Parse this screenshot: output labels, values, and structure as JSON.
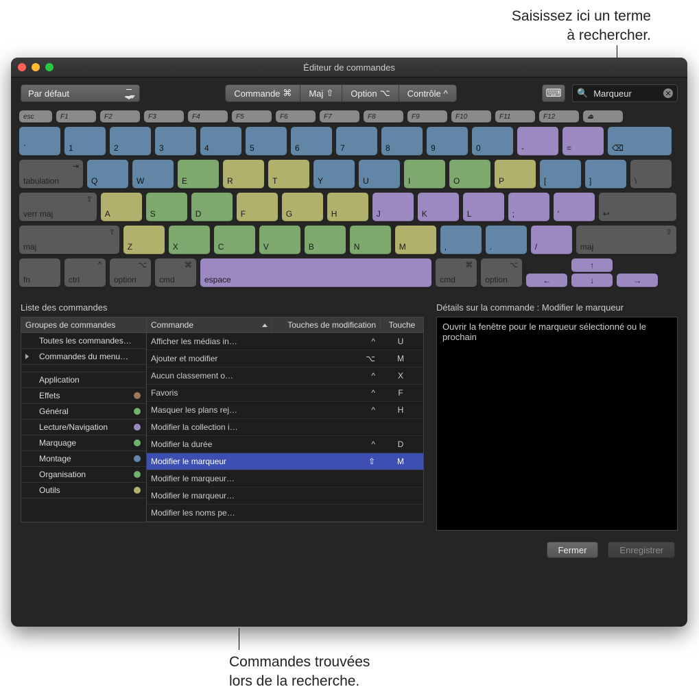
{
  "callouts": {
    "top": "Saisissez ici un terme\nà rechercher.",
    "bottom": "Commandes trouvées\nlors de la recherche."
  },
  "window": {
    "title": "Éditeur de commandes"
  },
  "toolbar": {
    "preset": "Par défaut",
    "mods": [
      {
        "label": "Commande",
        "glyph": "⌘"
      },
      {
        "label": "Maj",
        "glyph": "⇧"
      },
      {
        "label": "Option",
        "glyph": "⌥"
      },
      {
        "label": "Contrôle",
        "glyph": "^"
      }
    ],
    "search_value": "Marqueur"
  },
  "keyboard": {
    "frow": [
      "esc",
      "F1",
      "F2",
      "F3",
      "F4",
      "F5",
      "F6",
      "F7",
      "F8",
      "F9",
      "F10",
      "F11",
      "F12",
      "⏏"
    ],
    "row1": [
      {
        "l": "`",
        "c": "blue"
      },
      {
        "l": "1",
        "c": "blue"
      },
      {
        "l": "2",
        "c": "blue"
      },
      {
        "l": "3",
        "c": "blue"
      },
      {
        "l": "4",
        "c": "blue"
      },
      {
        "l": "5",
        "c": "blue"
      },
      {
        "l": "6",
        "c": "blue"
      },
      {
        "l": "7",
        "c": "blue"
      },
      {
        "l": "8",
        "c": "blue"
      },
      {
        "l": "9",
        "c": "blue"
      },
      {
        "l": "0",
        "c": "blue"
      },
      {
        "l": "-",
        "c": "purple"
      },
      {
        "l": "=",
        "c": "purple"
      },
      {
        "l": "⌫",
        "c": "blue",
        "w": 1.5
      }
    ],
    "row2": [
      {
        "l": "tabulation",
        "c": "dark",
        "w": 1.5,
        "sub": "⇥"
      },
      {
        "l": "Q",
        "c": "blue"
      },
      {
        "l": "W",
        "c": "blue"
      },
      {
        "l": "E",
        "c": "green"
      },
      {
        "l": "R",
        "c": "yellow"
      },
      {
        "l": "T",
        "c": "yellow"
      },
      {
        "l": "Y",
        "c": "blue"
      },
      {
        "l": "U",
        "c": "blue"
      },
      {
        "l": "I",
        "c": "green"
      },
      {
        "l": "O",
        "c": "green"
      },
      {
        "l": "P",
        "c": "yellow"
      },
      {
        "l": "[",
        "c": "blue"
      },
      {
        "l": "]",
        "c": "blue"
      },
      {
        "l": "\\",
        "c": "dark"
      }
    ],
    "row3": [
      {
        "l": "verr maj",
        "c": "dark",
        "w": 1.8,
        "sub": "⇪"
      },
      {
        "l": "A",
        "c": "yellow"
      },
      {
        "l": "S",
        "c": "green"
      },
      {
        "l": "D",
        "c": "green"
      },
      {
        "l": "F",
        "c": "yellow"
      },
      {
        "l": "G",
        "c": "yellow"
      },
      {
        "l": "H",
        "c": "yellow"
      },
      {
        "l": "J",
        "c": "purple"
      },
      {
        "l": "K",
        "c": "purple"
      },
      {
        "l": "L",
        "c": "purple"
      },
      {
        "l": ";",
        "c": "purple"
      },
      {
        "l": "'",
        "c": "purple"
      },
      {
        "l": "↩",
        "c": "dark",
        "w": 1.8
      }
    ],
    "row4": [
      {
        "l": "maj",
        "c": "dark",
        "w": 2.3,
        "sub": "⇧"
      },
      {
        "l": "Z",
        "c": "yellow"
      },
      {
        "l": "X",
        "c": "green"
      },
      {
        "l": "C",
        "c": "green"
      },
      {
        "l": "V",
        "c": "green"
      },
      {
        "l": "B",
        "c": "green"
      },
      {
        "l": "N",
        "c": "green"
      },
      {
        "l": "M",
        "c": "yellow"
      },
      {
        "l": ",",
        "c": "blue"
      },
      {
        "l": ".",
        "c": "blue"
      },
      {
        "l": "/",
        "c": "purple"
      },
      {
        "l": "maj",
        "c": "dark",
        "w": 2.3,
        "sub": "⇧"
      }
    ],
    "row5": [
      {
        "l": "fn",
        "c": "dark"
      },
      {
        "l": "ctrl",
        "c": "dark",
        "sub": "^"
      },
      {
        "l": "option",
        "c": "dark",
        "sub": "⌥"
      },
      {
        "l": "cmd",
        "c": "dark",
        "sub": "⌘"
      },
      {
        "l": "espace",
        "c": "purple",
        "w": 5.2
      },
      {
        "l": "cmd",
        "c": "dark",
        "sub": "⌘"
      },
      {
        "l": "option",
        "c": "dark",
        "sub": "⌥"
      },
      {
        "l": "←",
        "c": "purple",
        "h": 0.5
      },
      {
        "l": "↑↓",
        "c": "purple",
        "stack": true,
        "h": 0.5
      },
      {
        "l": "→",
        "c": "purple",
        "h": 0.5
      }
    ]
  },
  "lists": {
    "title": "Liste des commandes",
    "groups_header": "Groupes de commandes",
    "groups_top": [
      {
        "label": "Toutes les commandes…"
      },
      {
        "label": "Commandes du menu…",
        "disclosure": true
      }
    ],
    "groups": [
      {
        "label": "Application",
        "color": ""
      },
      {
        "label": "Effets",
        "color": "#a07858"
      },
      {
        "label": "Général",
        "color": "#6fb36f"
      },
      {
        "label": "Lecture/Navigation",
        "color": "#9d89c2"
      },
      {
        "label": "Marquage",
        "color": "#6fb36f"
      },
      {
        "label": "Montage",
        "color": "#6287a6"
      },
      {
        "label": "Organisation",
        "color": "#6fb36f"
      },
      {
        "label": "Outils",
        "color": "#b2b06d"
      }
    ],
    "columns": {
      "cmd": "Commande",
      "mod": "Touches de modification",
      "key": "Touche"
    },
    "rows": [
      {
        "cmd": "Afficher les médias in…",
        "mod": "^",
        "key": "U"
      },
      {
        "cmd": "Ajouter et modifier",
        "mod": "⌥",
        "key": "M"
      },
      {
        "cmd": "Aucun classement o…",
        "mod": "^",
        "key": "X"
      },
      {
        "cmd": "Favoris",
        "mod": "^",
        "key": "F"
      },
      {
        "cmd": "Masquer les plans rej…",
        "mod": "^",
        "key": "H"
      },
      {
        "cmd": "Modifier la collection i…",
        "mod": "",
        "key": ""
      },
      {
        "cmd": "Modifier la durée",
        "mod": "^",
        "key": "D"
      },
      {
        "cmd": "Modifier le marqueur",
        "mod": "⇧",
        "key": "M",
        "selected": true
      },
      {
        "cmd": "Modifier le marqueur…",
        "mod": "",
        "key": ""
      },
      {
        "cmd": "Modifier le marqueur…",
        "mod": "",
        "key": ""
      },
      {
        "cmd": "Modifier les noms pe…",
        "mod": "",
        "key": ""
      }
    ]
  },
  "details": {
    "title": "Détails sur la commande : Modifier le marqueur",
    "body": "Ouvrir la fenêtre pour le marqueur sélectionné ou le prochain"
  },
  "footer": {
    "close": "Fermer",
    "save": "Enregistrer"
  }
}
